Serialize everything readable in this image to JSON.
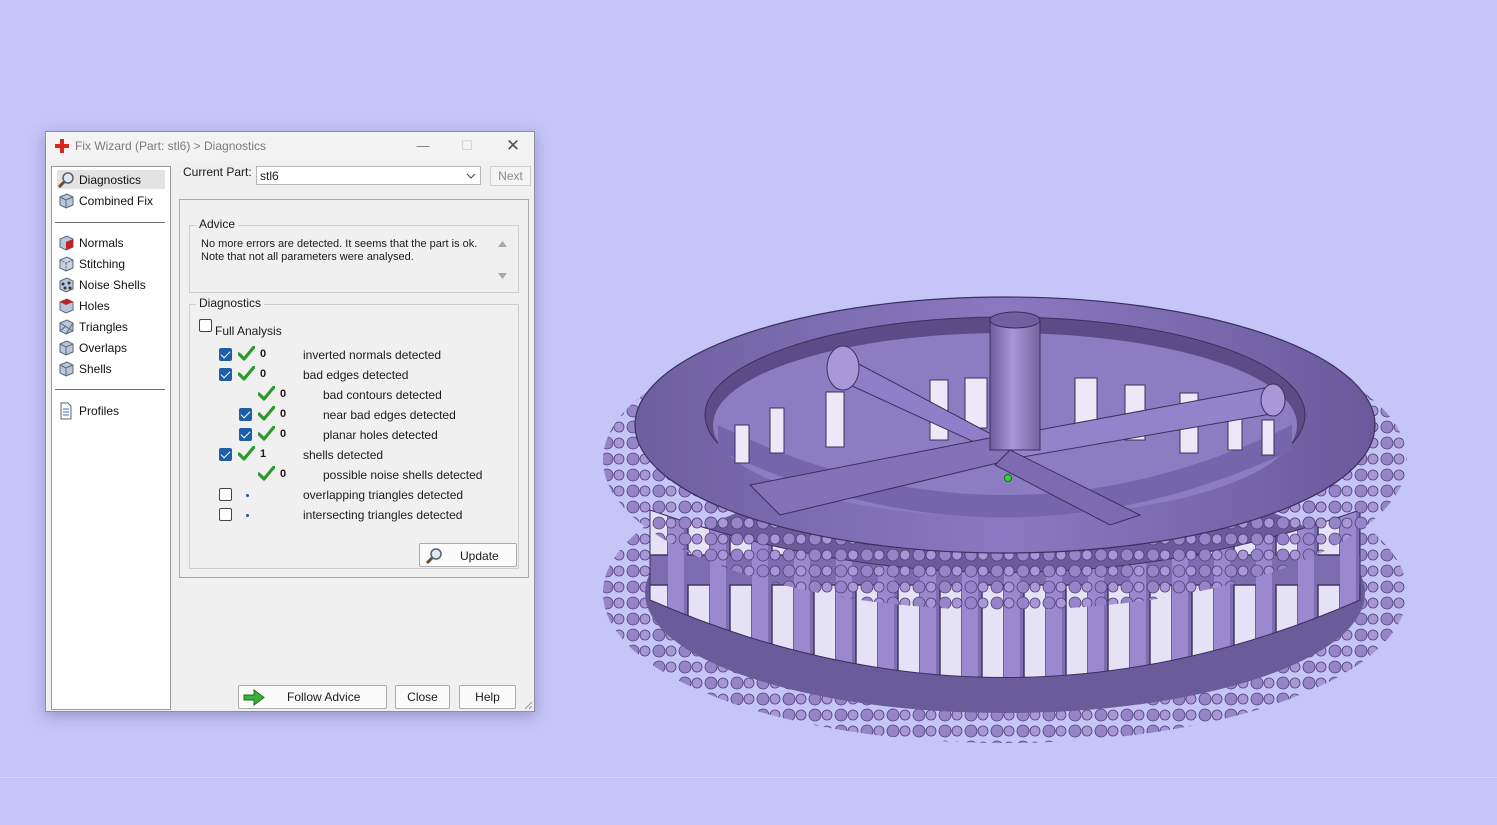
{
  "dialog": {
    "title": "Fix Wizard (Part: stl6) > Diagnostics",
    "buttons": {
      "minimize": "—",
      "maximize": "☐",
      "close": "✕"
    }
  },
  "nav": {
    "items": [
      {
        "label": "Diagnostics",
        "icon": "magnifier-icon",
        "selected": true
      },
      {
        "label": "Combined Fix",
        "icon": "cube-icon"
      },
      {
        "label": "Normals",
        "icon": "normals-cube-icon"
      },
      {
        "label": "Stitching",
        "icon": "stitching-cube-icon"
      },
      {
        "label": "Noise Shells",
        "icon": "noise-shells-icon"
      },
      {
        "label": "Holes",
        "icon": "holes-cube-icon"
      },
      {
        "label": "Triangles",
        "icon": "triangles-cube-icon"
      },
      {
        "label": "Overlaps",
        "icon": "overlaps-cube-icon"
      },
      {
        "label": "Shells",
        "icon": "shells-cube-icon"
      },
      {
        "label": "Profiles",
        "icon": "document-icon"
      }
    ]
  },
  "current_part": {
    "label": "Current Part:",
    "value": "stl6",
    "next_label": "Next"
  },
  "advice": {
    "title": "Advice",
    "text": "No more errors are detected. It seems that the part is ok. Note that not all parameters were analysed."
  },
  "diagnostics": {
    "title": "Diagnostics",
    "full_analysis_label": "Full Analysis",
    "full_analysis_checked": false,
    "rows": [
      {
        "checkbox": true,
        "checked": true,
        "status": "ok",
        "count": "0",
        "label": "inverted normals detected",
        "level": 0
      },
      {
        "checkbox": true,
        "checked": true,
        "status": "ok",
        "count": "0",
        "label": "bad edges detected",
        "level": 0
      },
      {
        "checkbox": false,
        "checked": false,
        "status": "ok",
        "count": "0",
        "label": "bad contours detected",
        "level": 1
      },
      {
        "checkbox": true,
        "checked": true,
        "status": "ok",
        "count": "0",
        "label": "near bad edges detected",
        "level": 1
      },
      {
        "checkbox": true,
        "checked": true,
        "status": "ok",
        "count": "0",
        "label": "planar holes detected",
        "level": 1
      },
      {
        "checkbox": true,
        "checked": true,
        "status": "ok",
        "count": "1",
        "label": "shells detected",
        "level": 0
      },
      {
        "checkbox": false,
        "checked": false,
        "status": "ok",
        "count": "0",
        "label": "possible noise shells detected",
        "level": 1
      },
      {
        "checkbox": true,
        "checked": false,
        "status": "not-analysed",
        "count": "",
        "label": "overlapping triangles detected",
        "level": 0
      },
      {
        "checkbox": true,
        "checked": false,
        "status": "not-analysed",
        "count": "",
        "label": "intersecting triangles detected",
        "level": 0
      }
    ],
    "update_label": "Update"
  },
  "footer": {
    "follow_advice": "Follow Advice",
    "close": "Close",
    "help": "Help"
  },
  "colors": {
    "background": "#c5c5f8",
    "model": "#8b76c4",
    "check_green": "#2a9a2a",
    "checkbox_blue": "#1e5ea8"
  }
}
